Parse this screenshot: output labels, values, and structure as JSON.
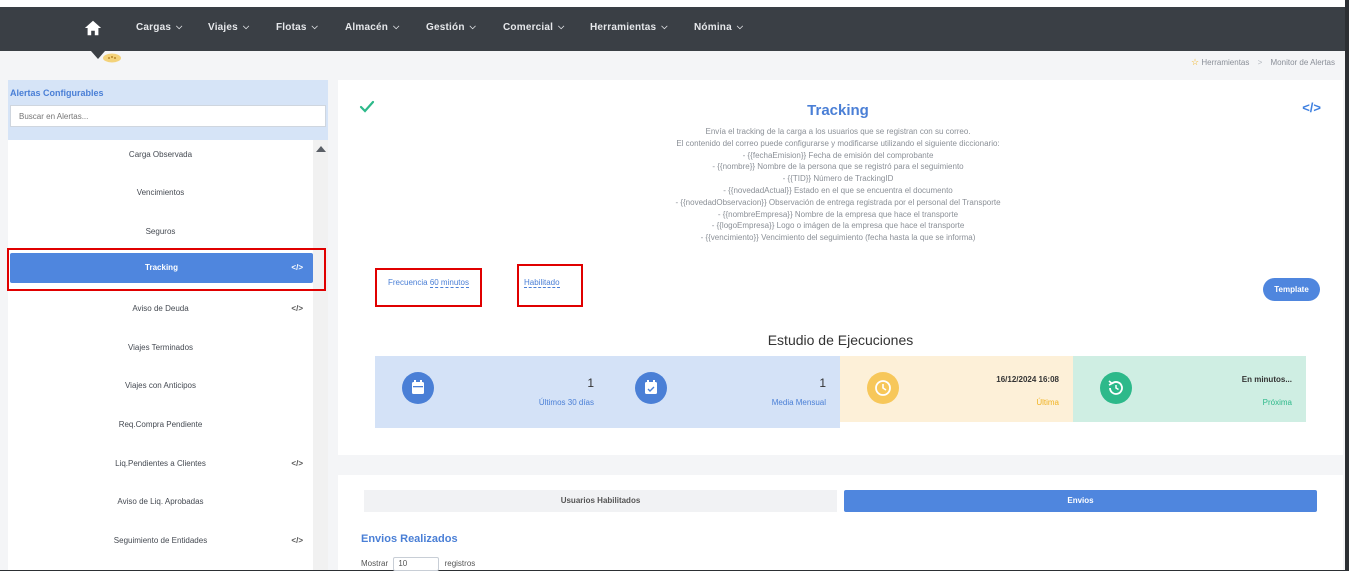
{
  "nav": {
    "items": [
      {
        "label": "Cargas"
      },
      {
        "label": "Viajes"
      },
      {
        "label": "Flotas"
      },
      {
        "label": "Almacén"
      },
      {
        "label": "Gestión"
      },
      {
        "label": "Comercial"
      },
      {
        "label": "Herramientas"
      },
      {
        "label": "Nómina"
      }
    ]
  },
  "breadcrumb": {
    "parent": "Herramientas",
    "current": "Monitor de Alertas"
  },
  "sidebar": {
    "title": "Alertas Configurables",
    "search_placeholder": "Buscar en Alertas...",
    "items": [
      {
        "label": "Carga Observada",
        "code": ""
      },
      {
        "label": "Vencimientos",
        "code": ""
      },
      {
        "label": "Seguros",
        "code": ""
      },
      {
        "label": "Tracking",
        "code": "</>"
      },
      {
        "label": "Aviso de Deuda",
        "code": "</>"
      },
      {
        "label": "Viajes Terminados",
        "code": ""
      },
      {
        "label": "Viajes con Anticipos",
        "code": ""
      },
      {
        "label": "Req.Compra Pendiente",
        "code": ""
      },
      {
        "label": "Liq.Pendientes a Clientes",
        "code": "</>"
      },
      {
        "label": "Aviso de Liq. Aprobadas",
        "code": ""
      },
      {
        "label": "Seguimiento de Entidades",
        "code": "</>"
      }
    ]
  },
  "panel": {
    "title": "Tracking",
    "code_icon": "</>",
    "description": [
      "Envía el tracking de la carga a los usuarios que se registran con su correo.",
      "El contenido del correo puede configurarse y modificarse utilizando el siguiente diccionario:",
      "- {{fechaEmision}} Fecha de emisión del comprobante",
      "- {{nombre}} Nombre de la persona que se registró para el seguimiento",
      "- {{TID}} Número de TrackingID",
      "- {{novedadActual}} Estado en el que se encuentra el documento",
      "- {{novedadObservacion}} Observación de entrega registrada por el personal del Transporte",
      "- {{nombreEmpresa}} Nombre de la empresa que hace el transporte",
      "- {{logoEmpresa}} Logo o imágen de la empresa que hace el transporte",
      "- {{vencimiento}} Vencimiento del seguimiento (fecha hasta la que se informa)"
    ],
    "frequency_prefix": "Frecuencia",
    "frequency_value": "60 minutos",
    "status": "Habilitado",
    "template_label": "Template"
  },
  "study": {
    "title": "Estudio de Ejecuciones",
    "cards": [
      {
        "value": "1",
        "label": "Últimos 30 días",
        "bg": "#d4e2f7",
        "circle": "#4a7fd6",
        "label_color": "#4a7fd6",
        "icon": "calendar-icon"
      },
      {
        "value": "1",
        "label": "Media Mensual",
        "bg": "#d4e2f7",
        "circle": "#4a7fd6",
        "label_color": "#4a7fd6",
        "icon": "calendar-check-icon"
      },
      {
        "value": "16/12/2024 16:08",
        "label": "Última",
        "bg": "#fdf0d8",
        "circle": "#f7c75a",
        "label_color": "#f0b323",
        "icon": "clock-icon"
      },
      {
        "value": "En minutos...",
        "label": "Próxima",
        "bg": "#cfeee3",
        "circle": "#2db98a",
        "label_color": "#2db98a",
        "icon": "history-icon"
      }
    ]
  },
  "bottom": {
    "tabs": [
      {
        "label": "Usuarios Habilitados",
        "active": false
      },
      {
        "label": "Envios",
        "active": true
      }
    ],
    "title": "Envios Realizados",
    "show_prefix": "Mostrar",
    "show_value": "10",
    "show_suffix": "registros"
  },
  "colors": {
    "accent": "#4f86de",
    "navbar": "#3a3f45",
    "highlight_box": "#e00000"
  }
}
